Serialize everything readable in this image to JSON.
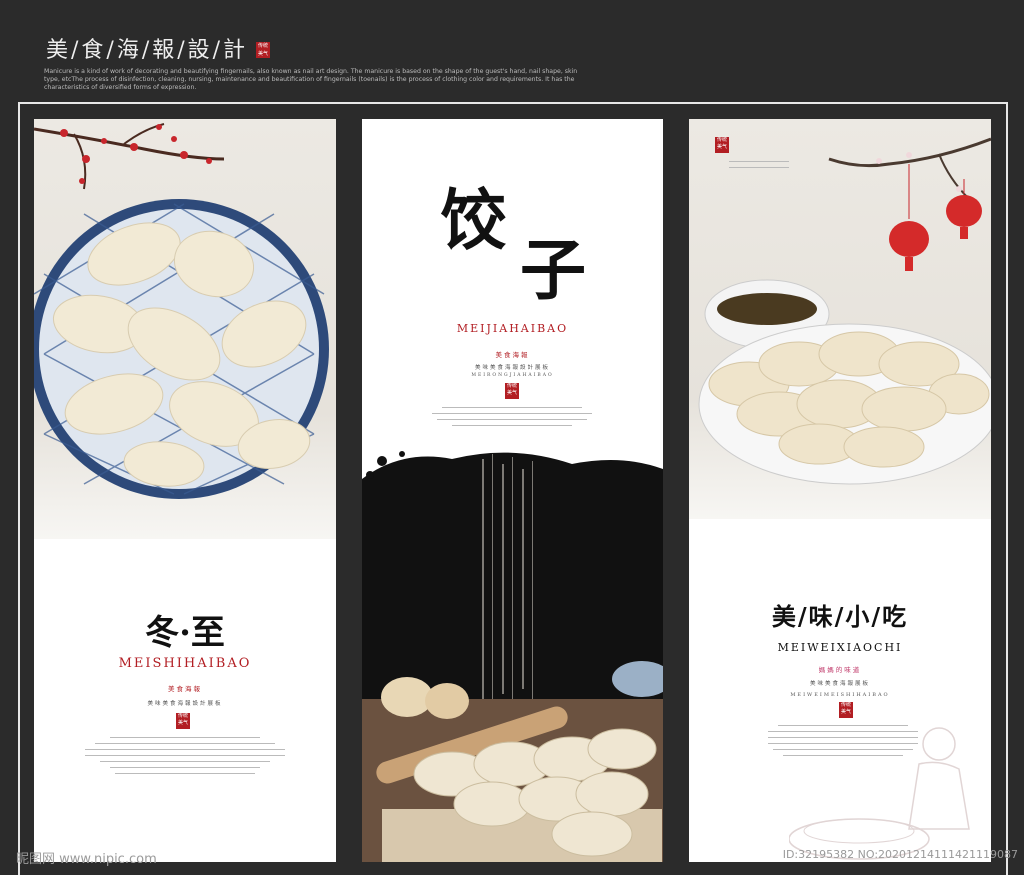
{
  "header": {
    "title": "美/食/海/報/設/計",
    "seal": "传统\n美气",
    "description": "Manicure is a kind of work of decorating and beautifying fingernails, also known as nail art design. The manicure is based on the shape of the guest's hand, nail shape, skin type, etcThe process of disinfection, cleaning, nursing, maintenance and beautification of fingernails (toenails) is the process of clothing color and requirements. It has the characteristics of diversified forms of expression."
  },
  "panel1": {
    "title": "冬·至",
    "pinyin": "MEISHIHAIBAO",
    "sub_red": "美食海報",
    "sub_small": "美味美食海報設計展板",
    "seal": "传统\n美气"
  },
  "panel2": {
    "title_a": "饺",
    "title_b": "子",
    "pinyin": "MEIJIAHAIBAO",
    "sub_red": "美食海報",
    "sub_small": "美味美食海報設計展板",
    "sub_tiny": "MEIRONGJIAHAIBAO",
    "seal": "传统\n美气"
  },
  "panel3": {
    "title": "美/味/小/吃",
    "pinyin": "MEIWEIXIAOCHI",
    "sub_pink": "媽媽的味道",
    "sub_small": "美味美食海報展板",
    "sub_tiny": "MEIWEIMEISHIHAIBAO",
    "seal": "传统\n美气",
    "top_seal": "传统\n美气"
  },
  "watermark": {
    "left": "昵图网 www.nipic.com",
    "right": "ID:32195382 NO:20201214111421119087"
  },
  "colors": {
    "accent_red": "#b21e23",
    "background": "#2b2b2b"
  }
}
